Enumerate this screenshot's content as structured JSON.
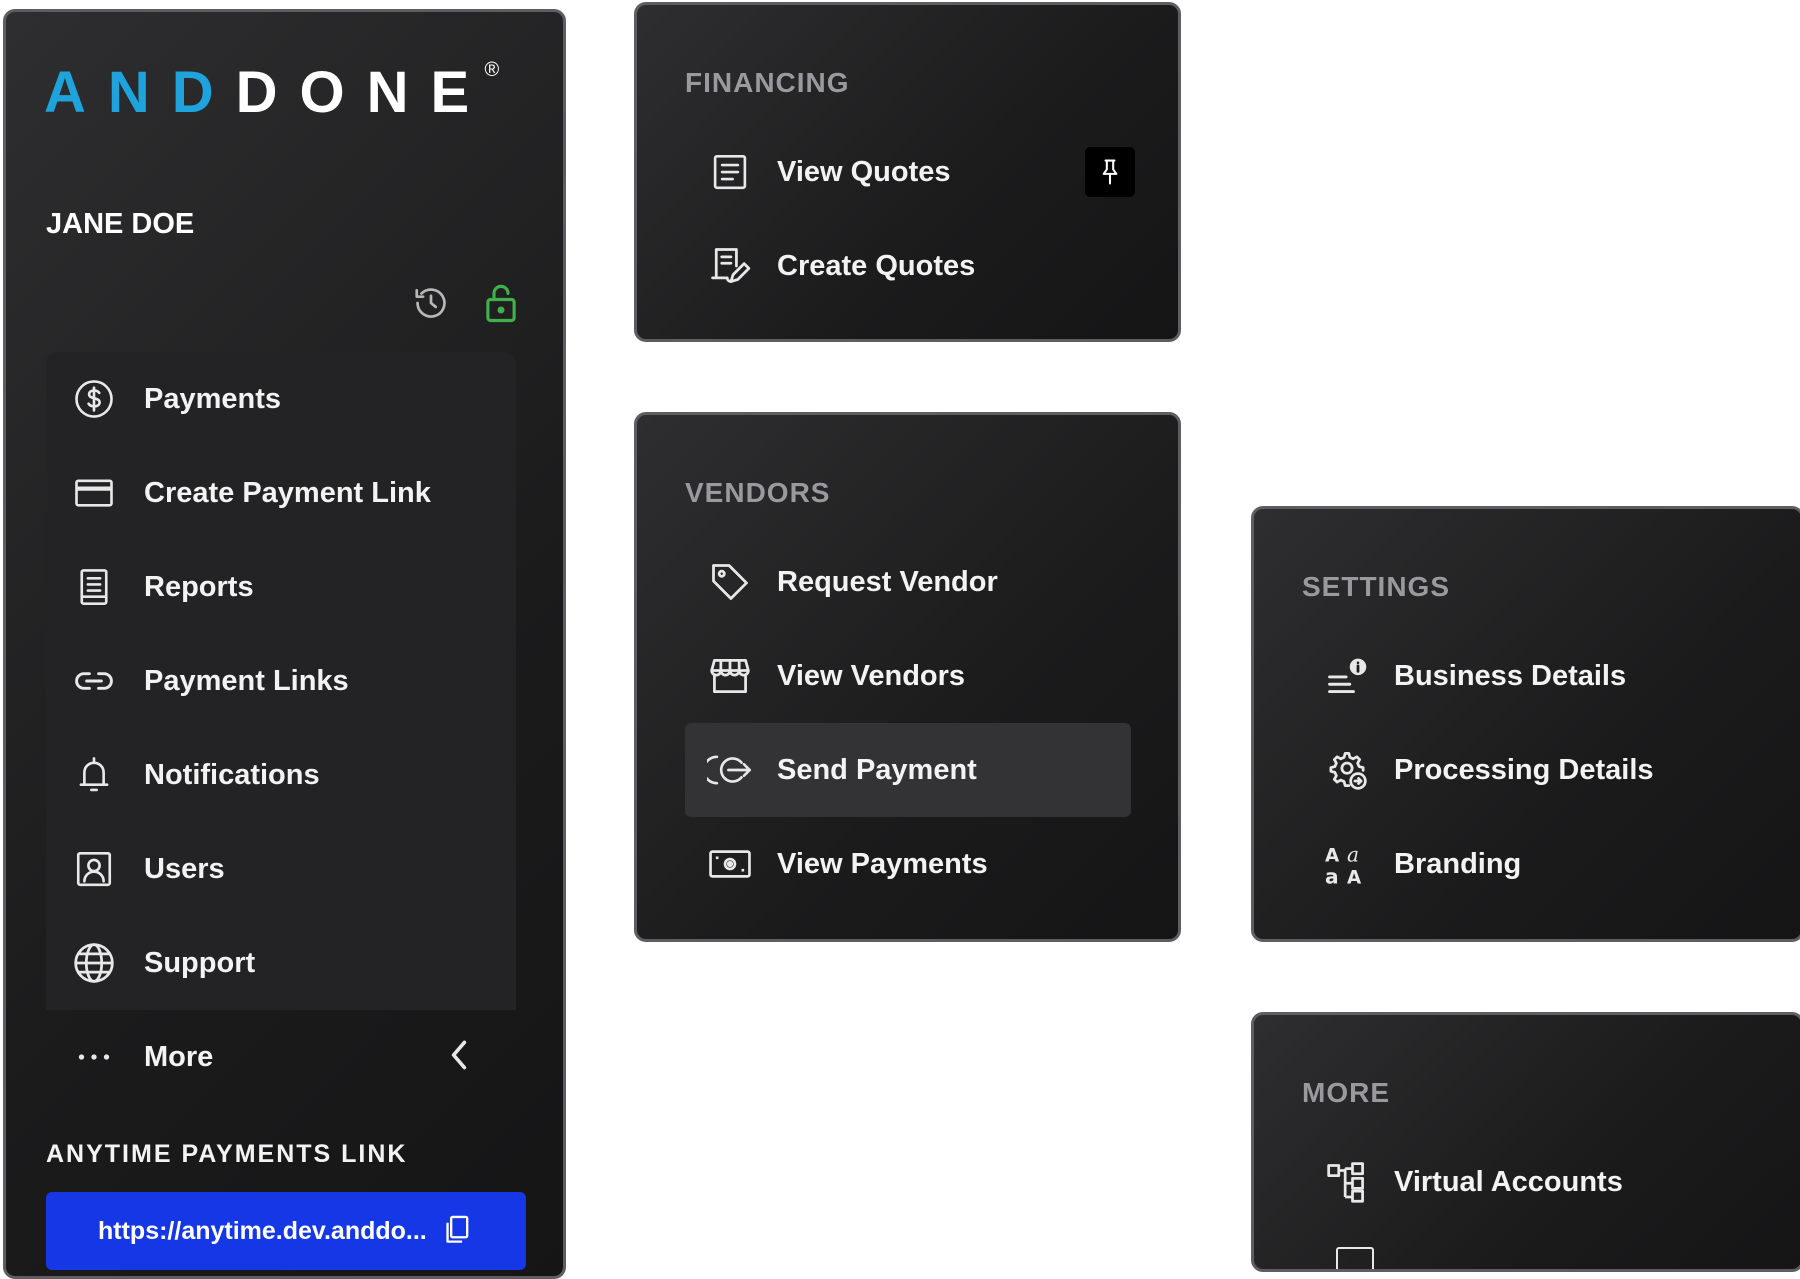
{
  "brand": {
    "logo_part1": "AND",
    "logo_part2": "DONE",
    "reg_mark": "®",
    "accent_color": "#1ea3dd"
  },
  "user": {
    "name": "JANE DOE"
  },
  "header_icons": [
    "history-icon",
    "unlock-icon"
  ],
  "sidebar": {
    "items": [
      {
        "label": "Payments",
        "icon": "dollar-circle-icon"
      },
      {
        "label": "Create Payment Link",
        "icon": "credit-card-icon"
      },
      {
        "label": "Reports",
        "icon": "report-icon"
      },
      {
        "label": "Payment Links",
        "icon": "link-icon"
      },
      {
        "label": "Notifications",
        "icon": "bell-icon"
      },
      {
        "label": "Users",
        "icon": "user-icon"
      },
      {
        "label": "Support",
        "icon": "globe-icon"
      },
      {
        "label": "More",
        "icon": "more-dots-icon"
      }
    ]
  },
  "anytime": {
    "label": "ANYTIME PAYMENTS LINK",
    "link": "https://anytime.dev.anddo...",
    "button_color": "#1637e6"
  },
  "financing": {
    "title": "FINANCING",
    "items": [
      {
        "label": "View Quotes",
        "icon": "document-icon"
      },
      {
        "label": "Create Quotes",
        "icon": "edit-document-icon"
      }
    ]
  },
  "vendors": {
    "title": "VENDORS",
    "items": [
      {
        "label": "Request Vendor",
        "icon": "tag-icon"
      },
      {
        "label": "View Vendors",
        "icon": "storefront-icon"
      },
      {
        "label": "Send Payment",
        "icon": "send-payment-icon",
        "active": true
      },
      {
        "label": "View Payments",
        "icon": "cash-icon"
      }
    ]
  },
  "settings": {
    "title": "SETTINGS",
    "items": [
      {
        "label": "Business Details",
        "icon": "info-list-icon"
      },
      {
        "label": "Processing Details",
        "icon": "gear-arrow-icon"
      },
      {
        "label": "Branding",
        "icon": "typography-icon"
      }
    ]
  },
  "more": {
    "title": "MORE",
    "items": [
      {
        "label": "Virtual Accounts",
        "icon": "hierarchy-icon"
      }
    ]
  },
  "colors": {
    "panel_border": "#5e5e62",
    "active_item": "#333335",
    "unlock_icon": "#3fb04a",
    "section_title": "#9a9a9e"
  }
}
